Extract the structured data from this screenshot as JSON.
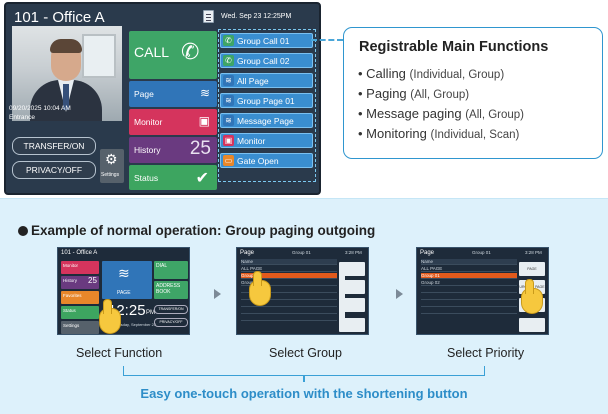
{
  "screen": {
    "title": "101 - Office A",
    "datetime": "Wed. Sep 23  12:25PM",
    "camera": {
      "date": "09/20/2025 10:04 AM",
      "label": "Entrance"
    },
    "left_buttons": [
      "TRANSFER/ON",
      "PRIVACY/OFF"
    ],
    "settings_label": "Settings",
    "tiles": {
      "call": "CALL",
      "page": "Page",
      "monitor": "Monitor",
      "history": "History",
      "history_count": "25",
      "status": "Status"
    },
    "shortcuts": [
      {
        "label": "Group Call 01",
        "icon": "phone-icon",
        "color": "#3ea567"
      },
      {
        "label": "Group Call 02",
        "icon": "phone-icon",
        "color": "#3ea567"
      },
      {
        "label": "All Page",
        "icon": "page-icon",
        "color": "#3075b8"
      },
      {
        "label": "Group Page 01",
        "icon": "page-icon",
        "color": "#3075b8"
      },
      {
        "label": "Message Page",
        "icon": "page-icon",
        "color": "#3075b8"
      },
      {
        "label": "Monitor",
        "icon": "monitor-icon",
        "color": "#d5345d"
      },
      {
        "label": "Gate Open",
        "icon": "gate-icon",
        "color": "#e8872a"
      }
    ]
  },
  "functions": {
    "title": "Registrable Main Functions",
    "items": [
      {
        "main": "Calling",
        "sub": "(Individual, Group)"
      },
      {
        "main": "Paging",
        "sub": "(All, Group)"
      },
      {
        "main": "Message paging",
        "sub": "(All, Group)"
      },
      {
        "main": "Monitoring",
        "sub": "(Individual, Scan)"
      }
    ]
  },
  "example": {
    "title": "Example of normal operation: Group paging outgoing",
    "captions": [
      "Select Function",
      "Select Group",
      "Select Priority"
    ],
    "tagline": "Easy one-touch operation with the shortening button",
    "shot1": {
      "title": "101 - Office A",
      "tiles": [
        "Monitor",
        "History",
        "Favorites",
        "Status",
        "Settings"
      ],
      "history_count": "25",
      "page": "PAGE",
      "dial": "DIAL",
      "address": "ADDRESS BOOK",
      "time": "12:25",
      "ampm": "PM",
      "date": "Wednesday, September 23",
      "transfer": "TRANSFER/ON",
      "privacy": "PRIVACY/OFF"
    },
    "shot2": {
      "title": "Page",
      "group": "Group 01",
      "time": "3:28 PM",
      "header": "Name",
      "rows": [
        "ALL PAGE",
        "Group 01",
        "Group 02"
      ]
    },
    "shot3": {
      "title": "Page",
      "group": "Group 01",
      "time": "3:28 PM",
      "header": "Name",
      "rows": [
        "ALL PAGE",
        "Group 01",
        "Group 02"
      ],
      "buttons": [
        "PAGE",
        "URGENT PAGE",
        "Pre-Recorded MESSAGE"
      ]
    }
  }
}
